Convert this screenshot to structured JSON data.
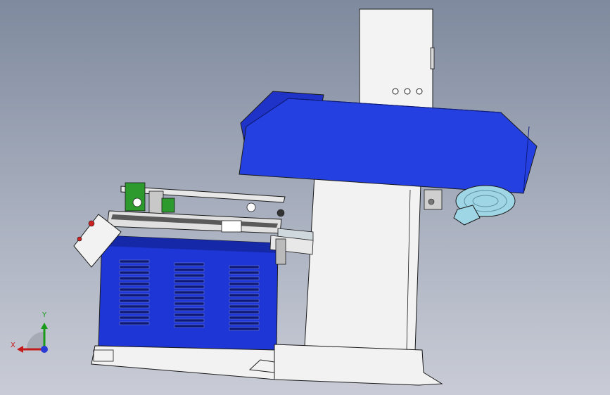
{
  "viewport": {
    "background_top": "#7f8a9e",
    "background_bottom": "#c9ccd6"
  },
  "colors": {
    "machine_blue": "#1f36d6",
    "hood_blue": "#2440e0",
    "panel_white": "#f2f2f2",
    "motor_cyan": "#9fd6e6",
    "gear_green": "#2d9a2d",
    "outline": "#1a1a1a"
  },
  "axis_triad": {
    "y_label": "Y",
    "x_label": "X",
    "y_color": "#1a9a1a",
    "x_color": "#c51a1a",
    "z_color": "#2a3ad6"
  },
  "scene": {
    "parts": [
      "column-tower",
      "top-hood",
      "motor-assembly",
      "cutting-table",
      "base-cabinet",
      "vent-grille",
      "control-box",
      "floor-base"
    ]
  }
}
